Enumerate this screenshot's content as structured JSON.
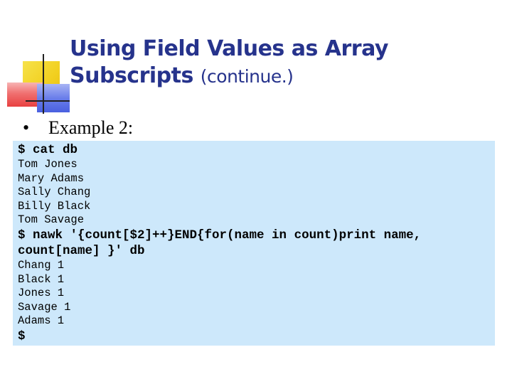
{
  "slide": {
    "title_main_line1": "Using Field Values as Array",
    "title_main_line2": "Subscripts ",
    "title_suffix": "(continue.)",
    "bullet_symbol": "•",
    "bullet_text": "Example 2:"
  },
  "terminal": {
    "lines": [
      {
        "kind": "cmd",
        "text": "$ cat db"
      },
      {
        "kind": "out",
        "text": "Tom Jones"
      },
      {
        "kind": "out",
        "text": "Mary Adams"
      },
      {
        "kind": "out",
        "text": "Sally Chang"
      },
      {
        "kind": "out",
        "text": "Billy Black"
      },
      {
        "kind": "out",
        "text": "Tom Savage"
      },
      {
        "kind": "cmd",
        "text": "$ nawk '{count[$2]++}END{for(name in count)print name,"
      },
      {
        "kind": "cmd",
        "text": "count[name] }' db"
      },
      {
        "kind": "out",
        "text": "Chang 1"
      },
      {
        "kind": "out",
        "text": "Black 1"
      },
      {
        "kind": "out",
        "text": "Jones 1"
      },
      {
        "kind": "out",
        "text": "Savage 1"
      },
      {
        "kind": "out",
        "text": "Adams 1"
      },
      {
        "kind": "cmd",
        "text": "$"
      }
    ]
  },
  "colors": {
    "title": "#26338c",
    "code_background": "#cde8fb"
  }
}
